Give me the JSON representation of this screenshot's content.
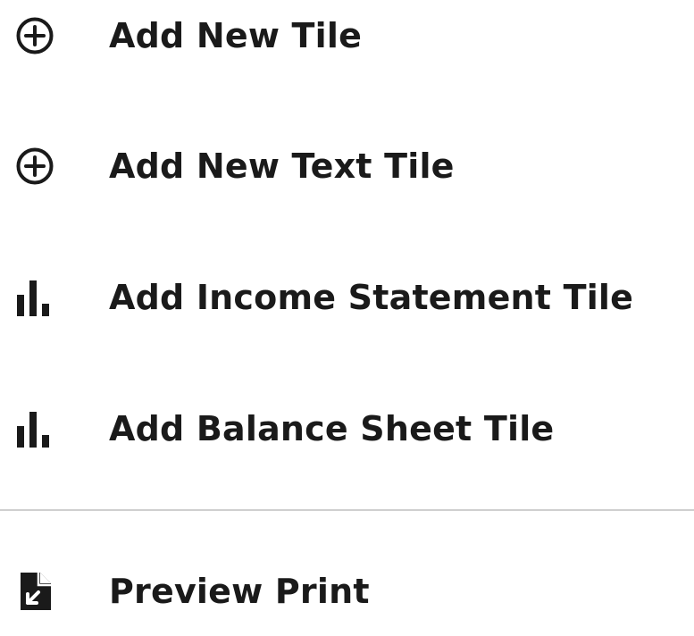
{
  "menu": {
    "items": [
      {
        "label": "Add New Tile",
        "icon": "plus-circle-icon"
      },
      {
        "label": "Add New Text Tile",
        "icon": "plus-circle-icon"
      },
      {
        "label": "Add Income Statement Tile",
        "icon": "bar-chart-icon"
      },
      {
        "label": "Add Balance Sheet Tile",
        "icon": "bar-chart-icon"
      }
    ],
    "footer_items": [
      {
        "label": "Preview Print",
        "icon": "document-export-icon"
      }
    ]
  }
}
